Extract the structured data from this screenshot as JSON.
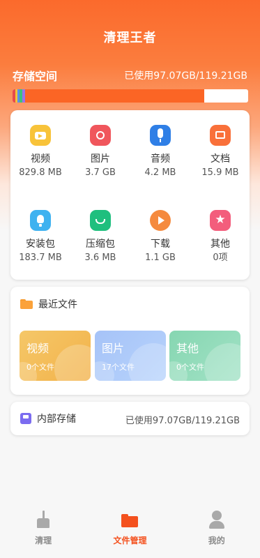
{
  "header": {
    "title": "清理王者",
    "storage_label": "存储空间",
    "storage_value": "已使用97.07GB/119.21GB",
    "usage_fraction": 0.8143
  },
  "categories": [
    {
      "name": "视频",
      "size": "829.8 MB",
      "icon": "video-icon",
      "color": "#f8c33a"
    },
    {
      "name": "图片",
      "size": "3.7 GB",
      "icon": "image-icon",
      "color": "#f0565c"
    },
    {
      "name": "音频",
      "size": "4.2 MB",
      "icon": "microphone-icon",
      "color": "#2f7fe6"
    },
    {
      "name": "文档",
      "size": "15.9 MB",
      "icon": "document-icon",
      "color": "#f9703a"
    },
    {
      "name": "安装包",
      "size": "183.7 MB",
      "icon": "package-icon",
      "color": "#3fb2f0"
    },
    {
      "name": "压缩包",
      "size": "3.6 MB",
      "icon": "archive-icon",
      "color": "#1fbf7e"
    },
    {
      "name": "下载",
      "size": "1.1 GB",
      "icon": "download-icon",
      "color": "#f58a3e"
    },
    {
      "name": "其他",
      "size": "0项",
      "icon": "star-icon",
      "color": "#f35d7c"
    }
  ],
  "recent": {
    "title": "最近文件",
    "tiles": [
      {
        "label": "视频",
        "count": "0个文件",
        "color": "#f5c05a"
      },
      {
        "label": "图片",
        "count": "17个文件",
        "color": "#a8c6f8"
      },
      {
        "label": "其他",
        "count": "0个文件",
        "color": "#8fd9b8"
      }
    ]
  },
  "internal_storage": {
    "title": "内部存储",
    "value": "已使用97.07GB/119.21GB"
  },
  "tabs": [
    {
      "label": "清理",
      "icon": "broom-icon",
      "active": false
    },
    {
      "label": "文件管理",
      "icon": "folder-icon",
      "active": true
    },
    {
      "label": "我的",
      "icon": "profile-icon",
      "active": false
    }
  ],
  "colors": {
    "accent": "#f4511e",
    "bar_used": "#fb6525"
  }
}
